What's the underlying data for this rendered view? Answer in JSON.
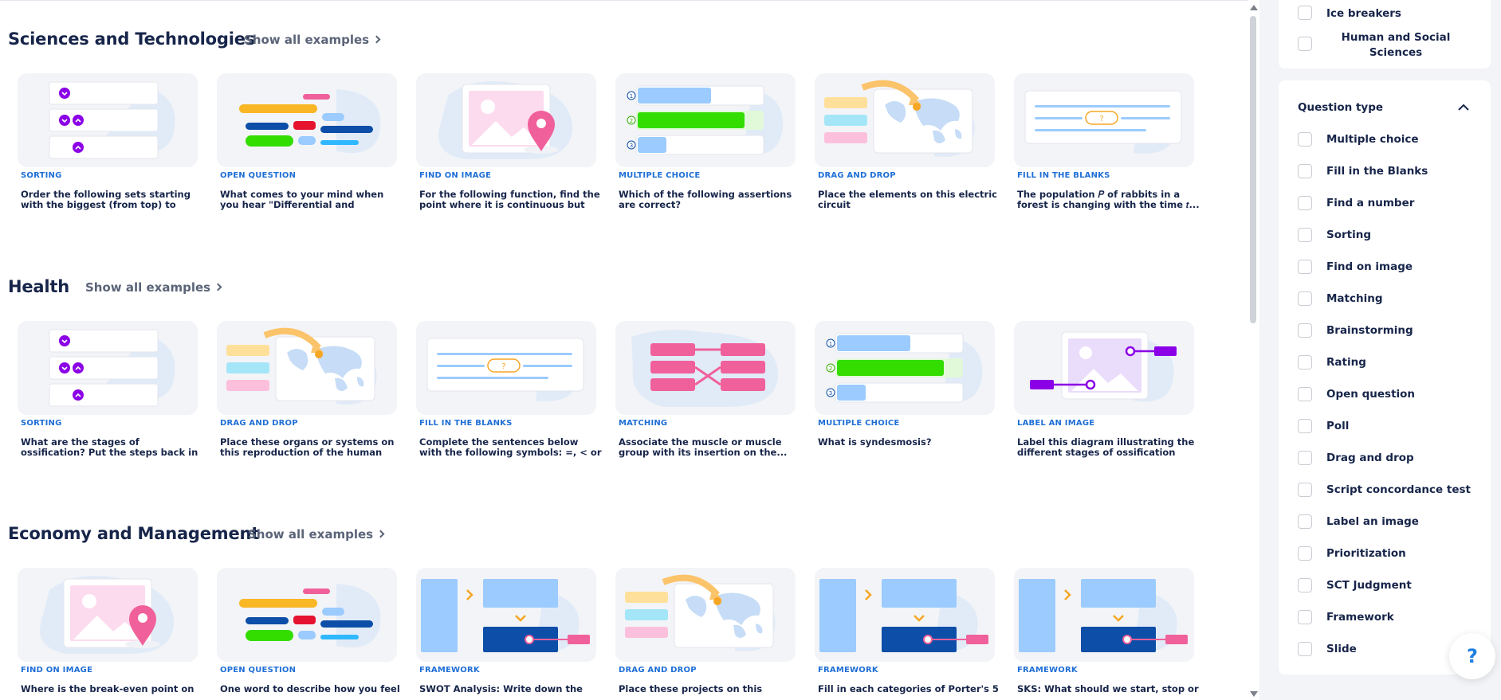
{
  "sections": [
    {
      "title": "Sciences and Technologies",
      "show_all": "Show all examples",
      "cards": [
        {
          "type": "SORTING",
          "desc": "Order the following sets starting with the biggest (from top) to the...",
          "icon": "sorting"
        },
        {
          "type": "OPEN QUESTION",
          "desc": "What comes to your mind when you hear \"Differential and Integral...",
          "icon": "open-question"
        },
        {
          "type": "FIND ON IMAGE",
          "desc": "For the following function, find the point where it is continuous but not...",
          "icon": "find-on-image"
        },
        {
          "type": "MULTIPLE CHOICE",
          "desc": "Which of the following assertions are correct?",
          "icon": "multiple-choice"
        },
        {
          "type": "DRAG AND DROP",
          "desc": "Place the elements on this electric circuit",
          "icon": "drag-and-drop"
        },
        {
          "type": "FILL IN THE BLANKS",
          "desc": "The population 𝑃 of rabbits in a forest is changing with the time 𝑡...",
          "icon": "fill-in-the-blanks"
        }
      ]
    },
    {
      "title": "Health",
      "show_all": "Show all examples",
      "cards": [
        {
          "type": "SORTING",
          "desc": "What are the stages of ossification? Put the steps back in order (from t...",
          "icon": "sorting"
        },
        {
          "type": "DRAG AND DROP",
          "desc": "Place these organs or systems on this reproduction of the human body",
          "icon": "drag-and-drop"
        },
        {
          "type": "FILL IN THE BLANKS",
          "desc": "Complete the sentences below with the following symbols: =, < or >.",
          "icon": "fill-in-the-blanks"
        },
        {
          "type": "MATCHING",
          "desc": "Associate the muscle or muscle group with its insertion on the...",
          "icon": "matching"
        },
        {
          "type": "MULTIPLE CHOICE",
          "desc": "What is syndesmosis?",
          "icon": "multiple-choice"
        },
        {
          "type": "LABEL AN IMAGE",
          "desc": "Label this diagram illustrating the different stages of ossification",
          "icon": "label-an-image"
        }
      ]
    },
    {
      "title": "Economy and Management",
      "show_all": "Show all examples",
      "cards": [
        {
          "type": "FIND ON IMAGE",
          "desc": "Where is the break-even point on",
          "icon": "find-on-image"
        },
        {
          "type": "OPEN QUESTION",
          "desc": "One word to describe how you feel",
          "icon": "open-question"
        },
        {
          "type": "FRAMEWORK",
          "desc": "SWOT Analysis: Write down the",
          "icon": "framework"
        },
        {
          "type": "DRAG AND DROP",
          "desc": "Place these projects on this",
          "icon": "drag-and-drop"
        },
        {
          "type": "FRAMEWORK",
          "desc": "Fill in each categories of Porter's 5",
          "icon": "framework"
        },
        {
          "type": "FRAMEWORK",
          "desc": "SKS: What should we start, stop or",
          "icon": "framework"
        }
      ]
    }
  ],
  "sidebar": {
    "topics_partial": [
      "Ice breakers",
      "Human and Social Sciences"
    ],
    "question_type": {
      "title": "Question type",
      "options": [
        "Multiple choice",
        "Fill in the Blanks",
        "Find a number",
        "Sorting",
        "Find on image",
        "Matching",
        "Brainstorming",
        "Rating",
        "Open question",
        "Poll",
        "Drag and drop",
        "Script concordance test",
        "Label an image",
        "Prioritization",
        "SCT Judgment",
        "Framework",
        "Slide"
      ]
    }
  },
  "help_label": "?",
  "colors": {
    "type_label": "#1f6fd6",
    "title": "#17254a",
    "purple": "#8b00e6",
    "pink": "#f0609a",
    "green": "#33dd00",
    "blue_light": "#9bcbff",
    "navy": "#0d4ea8"
  }
}
